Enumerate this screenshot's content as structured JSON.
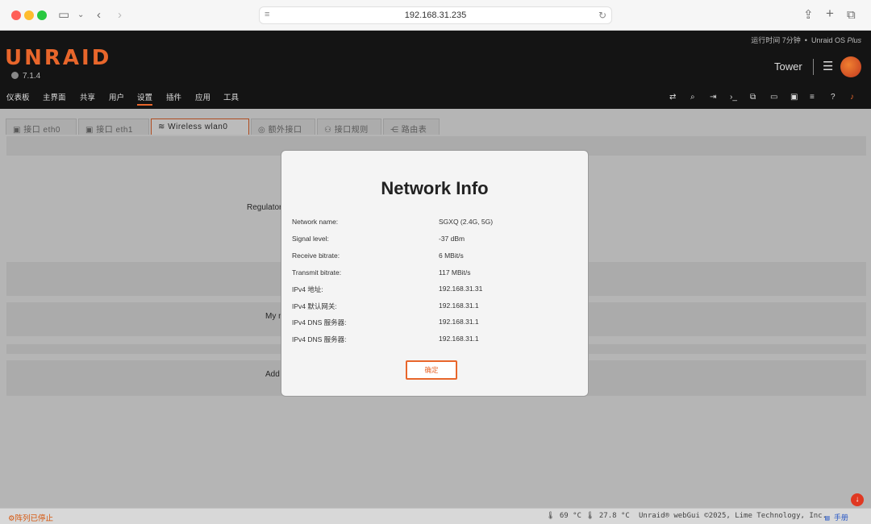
{
  "browser": {
    "url": "192.168.31.235"
  },
  "header": {
    "uptime_prefix": "运行时间 7分钟",
    "edition_prefix": "Unraid OS ",
    "edition_suffix": "Plus",
    "logo": "UNRAID",
    "version": "7.1.4",
    "server_name": "Tower"
  },
  "nav": {
    "items": [
      {
        "label": "仪表板"
      },
      {
        "label": "主界面"
      },
      {
        "label": "共享"
      },
      {
        "label": "用户"
      },
      {
        "label": "设置"
      },
      {
        "label": "插件"
      },
      {
        "label": "应用"
      },
      {
        "label": "工具"
      }
    ],
    "active": "设置"
  },
  "tabs": [
    {
      "label": "接口 eth0"
    },
    {
      "label": "接口 eth1"
    },
    {
      "label": "Wireless wlan0"
    },
    {
      "label": "额外接口"
    },
    {
      "label": "接口规则"
    },
    {
      "label": "路由表"
    }
  ],
  "background_labels": {
    "regulator": "Regulator",
    "my_n": "My n",
    "add": "Add"
  },
  "modal": {
    "title": "Network Info",
    "rows": [
      {
        "key": "Network name:",
        "value": "SGXQ (2.4G, 5G)"
      },
      {
        "key": "Signal level:",
        "value": "-37 dBm"
      },
      {
        "key": "Receive bitrate:",
        "value": "6 MBit/s"
      },
      {
        "key": "Transmit bitrate:",
        "value": "117 MBit/s"
      },
      {
        "key": "IPv4 地址:",
        "value": "192.168.31.31"
      },
      {
        "key": "IPv4 默认网关:",
        "value": "192.168.31.1"
      },
      {
        "key": "IPv4 DNS 服务器:",
        "value": "192.168.31.1"
      },
      {
        "key": "IPv4 DNS 服务器:",
        "value": "192.168.31.1"
      }
    ],
    "ok_label": "确定"
  },
  "footer": {
    "array_status": "阵列已停止",
    "temp1": "69 °C",
    "temp2": "27.8 °C",
    "copyright": "Unraid® webGui ©2025, Lime Technology, Inc.",
    "manual": "手册"
  },
  "colors": {
    "accent": "#e8662b",
    "header_bg": "#141414",
    "alert": "#e03822"
  }
}
